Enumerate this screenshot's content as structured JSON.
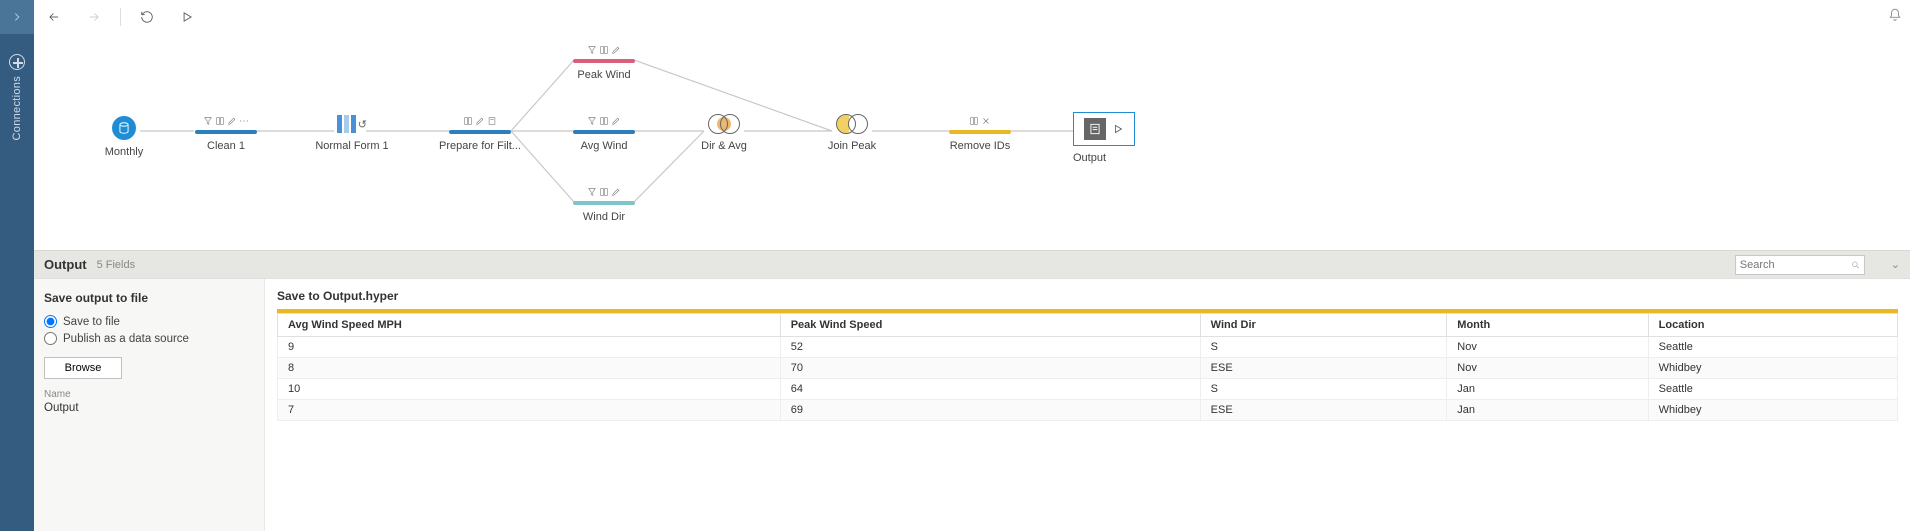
{
  "sidebar": {
    "label": "Connections"
  },
  "toolbar": {},
  "nodes": {
    "monthly": {
      "label": "Monthly"
    },
    "clean1": {
      "label": "Clean 1"
    },
    "normalform1": {
      "label": "Normal Form 1"
    },
    "prepare": {
      "label": "Prepare for Filt..."
    },
    "peakwind": {
      "label": "Peak Wind"
    },
    "avgwind": {
      "label": "Avg Wind"
    },
    "winddir": {
      "label": "Wind Dir"
    },
    "diravg": {
      "label": "Dir & Avg"
    },
    "joinpeak": {
      "label": "Join Peak"
    },
    "removeids": {
      "label": "Remove IDs"
    },
    "output": {
      "label": "Output"
    }
  },
  "panel": {
    "title": "Output",
    "fields_count": "5 Fields",
    "search_placeholder": "Search"
  },
  "config": {
    "section_title": "Save output to file",
    "radio_save": "Save to file",
    "radio_publish": "Publish as a data source",
    "browse": "Browse",
    "name_label": "Name",
    "name_value": "Output"
  },
  "preview": {
    "title": "Save to Output.hyper",
    "columns": [
      "Avg Wind Speed MPH",
      "Peak Wind Speed",
      "Wind Dir",
      "Month",
      "Location"
    ],
    "rows": [
      [
        "9",
        "52",
        "S",
        "Nov",
        "Seattle"
      ],
      [
        "8",
        "70",
        "ESE",
        "Nov",
        "Whidbey"
      ],
      [
        "10",
        "64",
        "S",
        "Jan",
        "Seattle"
      ],
      [
        "7",
        "69",
        "ESE",
        "Jan",
        "Whidbey"
      ]
    ]
  },
  "chart_data": {
    "type": "table",
    "title": "Save to Output.hyper",
    "columns": [
      "Avg Wind Speed MPH",
      "Peak Wind Speed",
      "Wind Dir",
      "Month",
      "Location"
    ],
    "rows": [
      {
        "Avg Wind Speed MPH": 9,
        "Peak Wind Speed": 52,
        "Wind Dir": "S",
        "Month": "Nov",
        "Location": "Seattle"
      },
      {
        "Avg Wind Speed MPH": 8,
        "Peak Wind Speed": 70,
        "Wind Dir": "ESE",
        "Month": "Nov",
        "Location": "Whidbey"
      },
      {
        "Avg Wind Speed MPH": 10,
        "Peak Wind Speed": 64,
        "Wind Dir": "S",
        "Month": "Jan",
        "Location": "Seattle"
      },
      {
        "Avg Wind Speed MPH": 7,
        "Peak Wind Speed": 69,
        "Wind Dir": "ESE",
        "Month": "Jan",
        "Location": "Whidbey"
      }
    ]
  }
}
